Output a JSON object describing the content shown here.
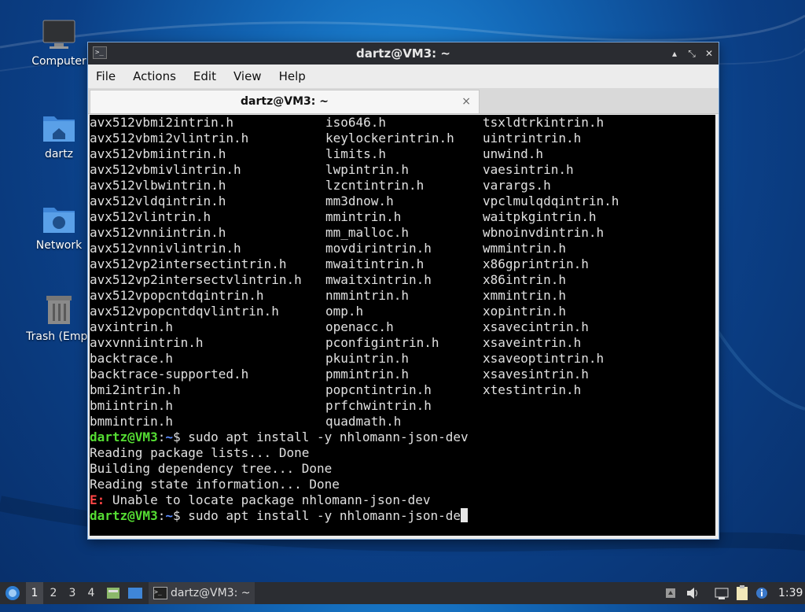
{
  "desktop": {
    "icons": [
      {
        "label": "Computer",
        "icon": "monitor-icon"
      },
      {
        "label": "dartz",
        "icon": "home-folder-icon"
      },
      {
        "label": "Network",
        "icon": "network-folder-icon"
      },
      {
        "label": "Trash (Empt",
        "icon": "trash-icon"
      }
    ]
  },
  "window": {
    "title": "dartz@VM3: ~",
    "menu": [
      "File",
      "Actions",
      "Edit",
      "View",
      "Help"
    ],
    "tab_label": "dartz@VM3: ~",
    "tab_close": "×",
    "controls": {
      "minimize": "▴",
      "maximize": "⤡",
      "close": "✕"
    }
  },
  "terminal": {
    "columns": [
      [
        "avx512vbmi2intrin.h",
        "avx512vbmi2vlintrin.h",
        "avx512vbmiintrin.h",
        "avx512vbmivlintrin.h",
        "avx512vlbwintrin.h",
        "avx512vldqintrin.h",
        "avx512vlintrin.h",
        "avx512vnniintrin.h",
        "avx512vnnivlintrin.h",
        "avx512vp2intersectintrin.h",
        "avx512vp2intersectvlintrin.h",
        "avx512vpopcntdqintrin.h",
        "avx512vpopcntdqvlintrin.h",
        "avxintrin.h",
        "avxvnniintrin.h",
        "backtrace.h",
        "backtrace-supported.h",
        "bmi2intrin.h",
        "bmiintrin.h",
        "bmmintrin.h"
      ],
      [
        "iso646.h",
        "keylockerintrin.h",
        "limits.h",
        "lwpintrin.h",
        "lzcntintrin.h",
        "mm3dnow.h",
        "mmintrin.h",
        "mm_malloc.h",
        "movdirintrin.h",
        "mwaitintrin.h",
        "mwaitxintrin.h",
        "nmmintrin.h",
        "omp.h",
        "openacc.h",
        "pconfigintrin.h",
        "pkuintrin.h",
        "pmmintrin.h",
        "popcntintrin.h",
        "prfchwintrin.h",
        "quadmath.h"
      ],
      [
        "tsxldtrkintrin.h",
        "uintrintrin.h",
        "unwind.h",
        "vaesintrin.h",
        "varargs.h",
        "vpclmulqdqintrin.h",
        "waitpkgintrin.h",
        "wbnoinvdintrin.h",
        "wmmintrin.h",
        "x86gprintrin.h",
        "x86intrin.h",
        "xmmintrin.h",
        "xopintrin.h",
        "xsavecintrin.h",
        "xsaveintrin.h",
        "xsaveoptintrin.h",
        "xsavesintrin.h",
        "xtestintrin.h"
      ]
    ],
    "prompt_user": "dartz@VM3",
    "prompt_sep": ":",
    "prompt_path": "~",
    "prompt_dollar": "$",
    "command1": " sudo apt install -y nhlomann-json-dev",
    "output": [
      "Reading package lists... Done",
      "Building dependency tree... Done",
      "Reading state information... Done"
    ],
    "error_prefix": "E:",
    "error_text": " Unable to locate package nhlomann-json-dev",
    "command2": " sudo apt install -y nhlomann-json-de"
  },
  "taskbar": {
    "workspaces": [
      "1",
      "2",
      "3",
      "4"
    ],
    "task_label": "dartz@VM3: ~",
    "clock": "1:39"
  },
  "colors": {
    "prompt_green": "#55dd33",
    "prompt_blue": "#5b8cff",
    "error_red": "#ff4444"
  }
}
